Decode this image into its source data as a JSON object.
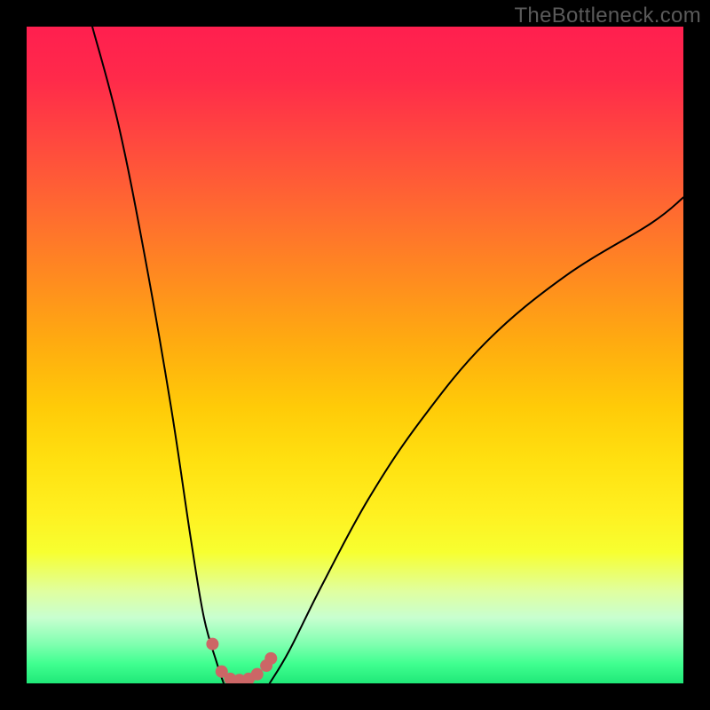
{
  "watermark": "TheBottleneck.com",
  "colors": {
    "background_frame": "#000000",
    "gradient_top": "#ff1f4f",
    "gradient_mid": "#ffe010",
    "gradient_bottom": "#20e878",
    "curve": "#000000",
    "dots": "#cc6666"
  },
  "chart_data": {
    "type": "line",
    "title": "",
    "xlabel": "",
    "ylabel": "",
    "xlim": [
      0,
      100
    ],
    "ylim": [
      0,
      100
    ],
    "grid": false,
    "legend": false,
    "note": "V-shaped bottleneck curve. X is relative component-match position; Y is bottleneck severity (red high, green low). Minimum ≈ x 30–37, y ≈ 0. Values estimated from pixel positions; no numeric axis labels are shown in the image.",
    "series": [
      {
        "name": "left-branch",
        "x": [
          10,
          14,
          18,
          22,
          25,
          27,
          29,
          30
        ],
        "y": [
          100,
          85,
          65,
          42,
          22,
          10,
          3,
          0
        ]
      },
      {
        "name": "right-branch",
        "x": [
          37,
          40,
          45,
          52,
          60,
          70,
          82,
          95,
          100
        ],
        "y": [
          0,
          5,
          15,
          28,
          40,
          52,
          62,
          70,
          74
        ]
      }
    ],
    "highlight_dots": [
      {
        "x": 28.3,
        "y": 6.0
      },
      {
        "x": 29.7,
        "y": 1.8
      },
      {
        "x": 31.0,
        "y": 0.7
      },
      {
        "x": 32.4,
        "y": 0.5
      },
      {
        "x": 33.8,
        "y": 0.7
      },
      {
        "x": 35.1,
        "y": 1.4
      },
      {
        "x": 36.5,
        "y": 2.7
      },
      {
        "x": 37.2,
        "y": 3.8
      }
    ],
    "dot_radius_px": 7
  }
}
